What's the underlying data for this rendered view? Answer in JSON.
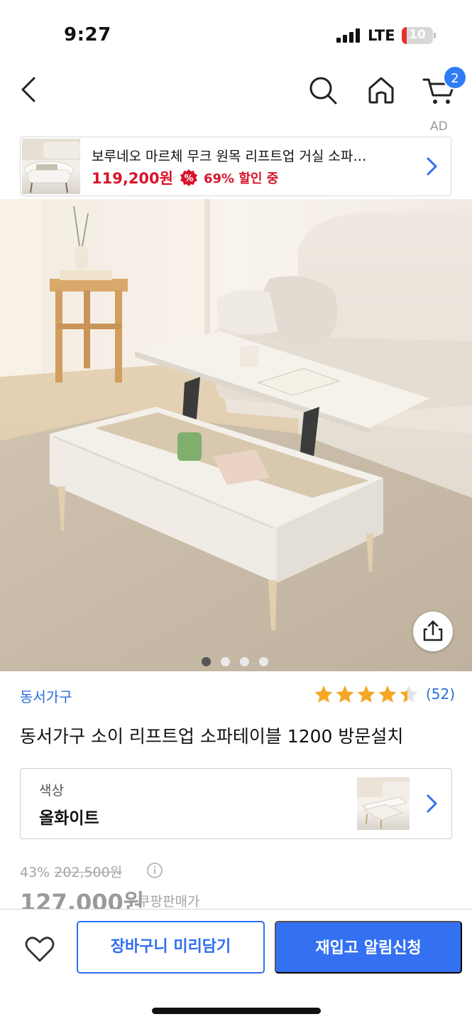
{
  "status_bar": {
    "time": "9:27",
    "network": "LTE",
    "battery": "10"
  },
  "nav": {
    "cart_count": "2",
    "icons": [
      "back-chevron-icon",
      "search-icon",
      "home-icon",
      "cart-icon"
    ]
  },
  "ad": {
    "label": "AD",
    "title": "보루네오 마르체 무크 원목 리프트업 거실 소파…",
    "price": "119,200원",
    "discount": "69% 할인 중",
    "accent_color": "#d8142b"
  },
  "gallery": {
    "page_count": 4,
    "active_page": 1
  },
  "product": {
    "brand": "동서가구",
    "rating": 4.5,
    "review_count": "(52)",
    "title": "동서가구 소이 리프트업 소파테이블 1200 방문설치"
  },
  "option": {
    "label": "색상",
    "value": "올화이트"
  },
  "price": {
    "discount_rate": "43%",
    "original": "202,500원",
    "current": "127,000원",
    "seller_tag": "쿠팡판매가"
  },
  "bottom_bar": {
    "cart_label": "장바구니 미리담기",
    "restock_label": "재입고 알림신청",
    "brand_color": "#3471f2"
  }
}
